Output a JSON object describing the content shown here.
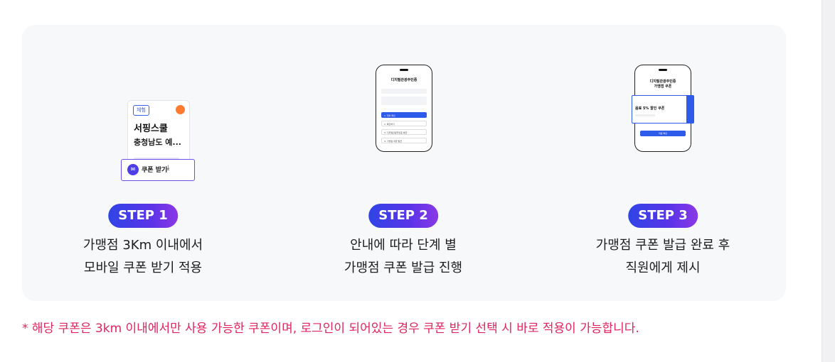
{
  "steps": [
    {
      "badge": "STEP 1",
      "line1": "가맹점 3Km 이내에서",
      "line2": "모바일 쿠폰 받기 적용",
      "illustration": {
        "tag": "체험",
        "title": "서핑스쿨",
        "subtitle": "충청남도 예...",
        "button_label": "쿠폰 받기"
      }
    },
    {
      "badge": "STEP 2",
      "line1": "안내에 따라 단계 별",
      "line2": "가맹점 쿠폰 발급 진행",
      "illustration": {
        "title": "디지털관광주민증",
        "rows": [
          "1. 위치 확인",
          "2. 확인하기",
          "3. 디지털관광주민증 발급",
          "4. 가맹점 쿠폰 발급"
        ]
      }
    },
    {
      "badge": "STEP 3",
      "line1": "가맹점 쿠폰 발급 완료 후",
      "line2": "직원에게 제시",
      "illustration": {
        "title_line1": "디지털관광주민증",
        "title_line2": "가맹점 쿠폰",
        "coupon_title": "음료 5% 할인 쿠폰",
        "button_label": "직원 확인"
      }
    }
  ],
  "note": "* 해당 쿠폰은 3km 이내에서만 사용 가능한 쿠폰이며, 로그인이 되어있는 경우 쿠폰 받기 선택 시 바로 적용이 가능합니다.",
  "colors": {
    "panel_bg": "#f7f8fa",
    "badge_gradient_start": "#2f44e6",
    "badge_gradient_end": "#8a38e6",
    "note_color": "#e0245e"
  }
}
